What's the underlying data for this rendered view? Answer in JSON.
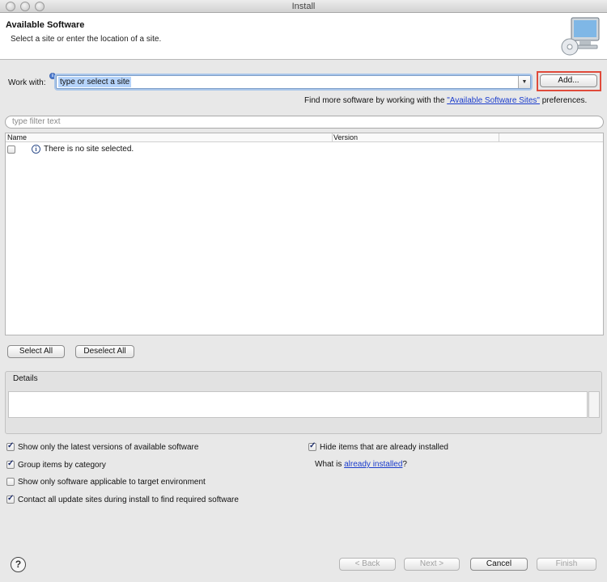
{
  "window": {
    "title": "Install"
  },
  "header": {
    "title": "Available Software",
    "subtitle": "Select a site or enter the location of a site.",
    "icon": "monitor-cd-icon"
  },
  "work_with": {
    "label": "Work with:",
    "value": "type or select a site",
    "add_button": "Add...",
    "find_more_prefix": "Find more software by working with the ",
    "find_more_link": "\"Available Software Sites\"",
    "find_more_suffix": " preferences."
  },
  "filter": {
    "placeholder": "type filter text"
  },
  "table": {
    "columns": [
      "Name",
      "Version"
    ],
    "rows": [
      {
        "name": "There is no site selected.",
        "version": "",
        "checked": false
      }
    ]
  },
  "selection_buttons": {
    "select_all": "Select All",
    "deselect_all": "Deselect All"
  },
  "details": {
    "label": "Details"
  },
  "options": {
    "latest_versions": {
      "label": "Show only the latest versions of available software",
      "checked": true
    },
    "group_by_category": {
      "label": "Group items by category",
      "checked": true
    },
    "applicable_only": {
      "label": "Show only software applicable to target environment",
      "checked": false
    },
    "contact_update_sites": {
      "label": "Contact all update sites during install to find required software",
      "checked": true
    },
    "hide_installed": {
      "label": "Hide items that are already installed",
      "checked": true
    },
    "what_is_prefix": "What is ",
    "what_is_link": "already installed",
    "what_is_suffix": "?"
  },
  "footer": {
    "help": "?",
    "back": "< Back",
    "next": "Next >",
    "cancel": "Cancel",
    "finish": "Finish"
  },
  "colors": {
    "highlight": "#e04a3a",
    "link": "#1a3ccc"
  }
}
